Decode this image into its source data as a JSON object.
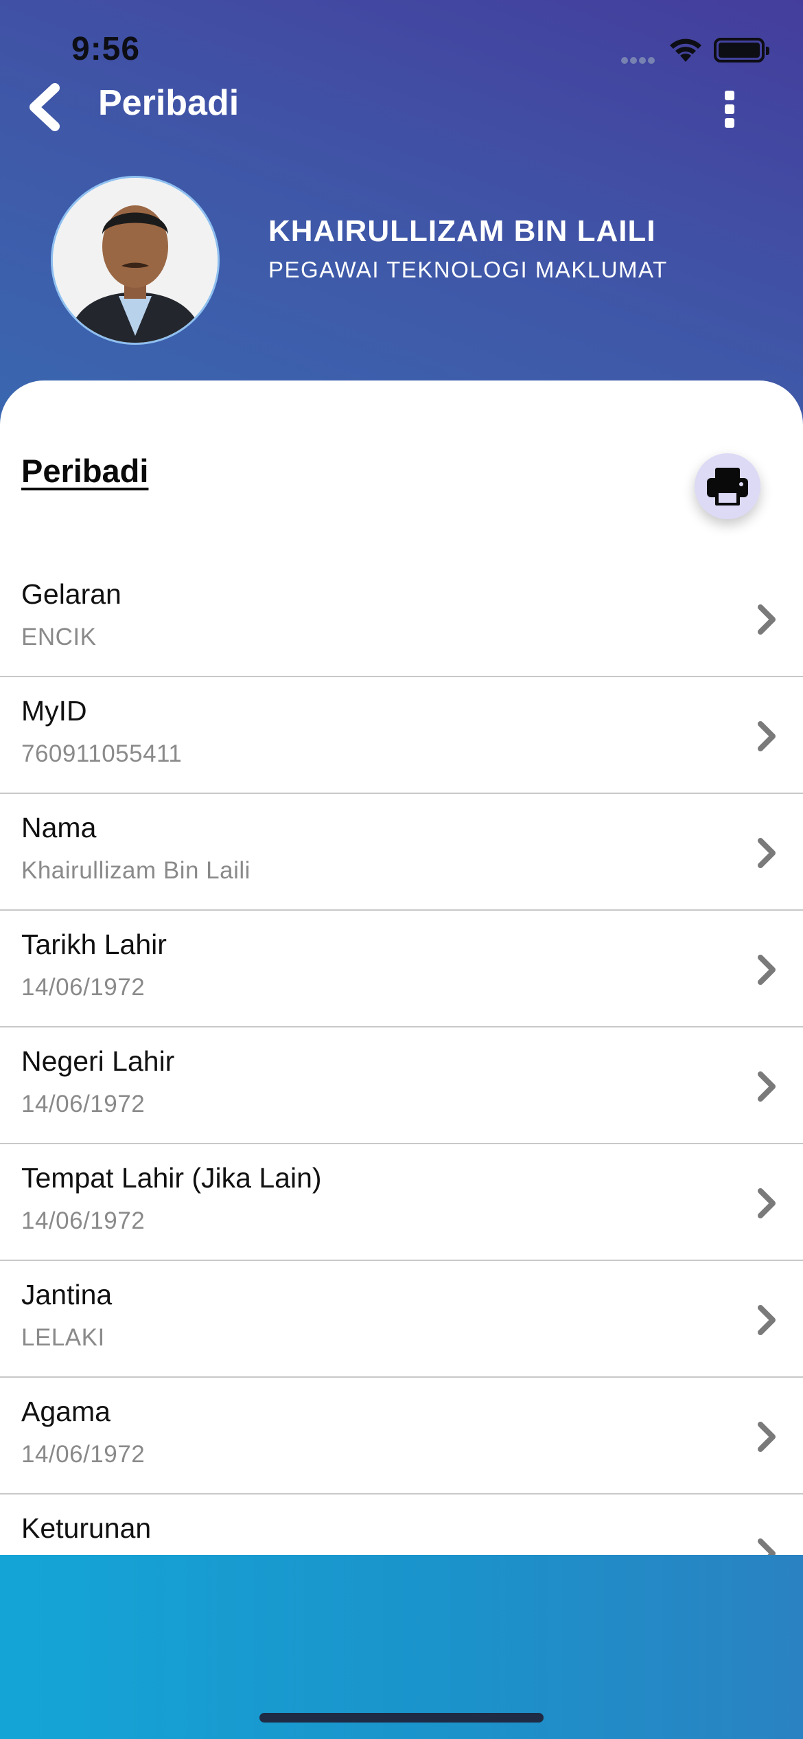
{
  "status_bar": {
    "time": "9:56"
  },
  "nav": {
    "title": "Peribadi"
  },
  "profile": {
    "name": "KHAIRULLIZAM BIN LAILI",
    "position": "PEGAWAI TEKNOLOGI MAKLUMAT"
  },
  "section": {
    "title": "Peribadi"
  },
  "icons": {
    "back": "chevron-left-icon",
    "more": "vertical-ellipsis-icon",
    "print": "printer-icon",
    "row": "chevron-right-icon"
  },
  "colors": {
    "header_gradient_start": "#3a67b0",
    "header_gradient_end": "#443d9c",
    "bottom_gradient_start": "#14a5d6",
    "bottom_gradient_end": "#2a82c2",
    "print_button_bg": "#dcdaf5"
  },
  "fields": [
    {
      "label": "Gelaran",
      "value": "ENCIK"
    },
    {
      "label": "MyID",
      "value": "760911055411"
    },
    {
      "label": "Nama",
      "value": "Khairullizam Bin Laili"
    },
    {
      "label": "Tarikh Lahir",
      "value": "14/06/1972"
    },
    {
      "label": "Negeri Lahir",
      "value": "14/06/1972"
    },
    {
      "label": "Tempat Lahir (Jika Lain)",
      "value": "14/06/1972"
    },
    {
      "label": "Jantina",
      "value": "LELAKI"
    },
    {
      "label": "Agama",
      "value": "14/06/1972"
    },
    {
      "label": "Keturunan",
      "value": ""
    }
  ]
}
